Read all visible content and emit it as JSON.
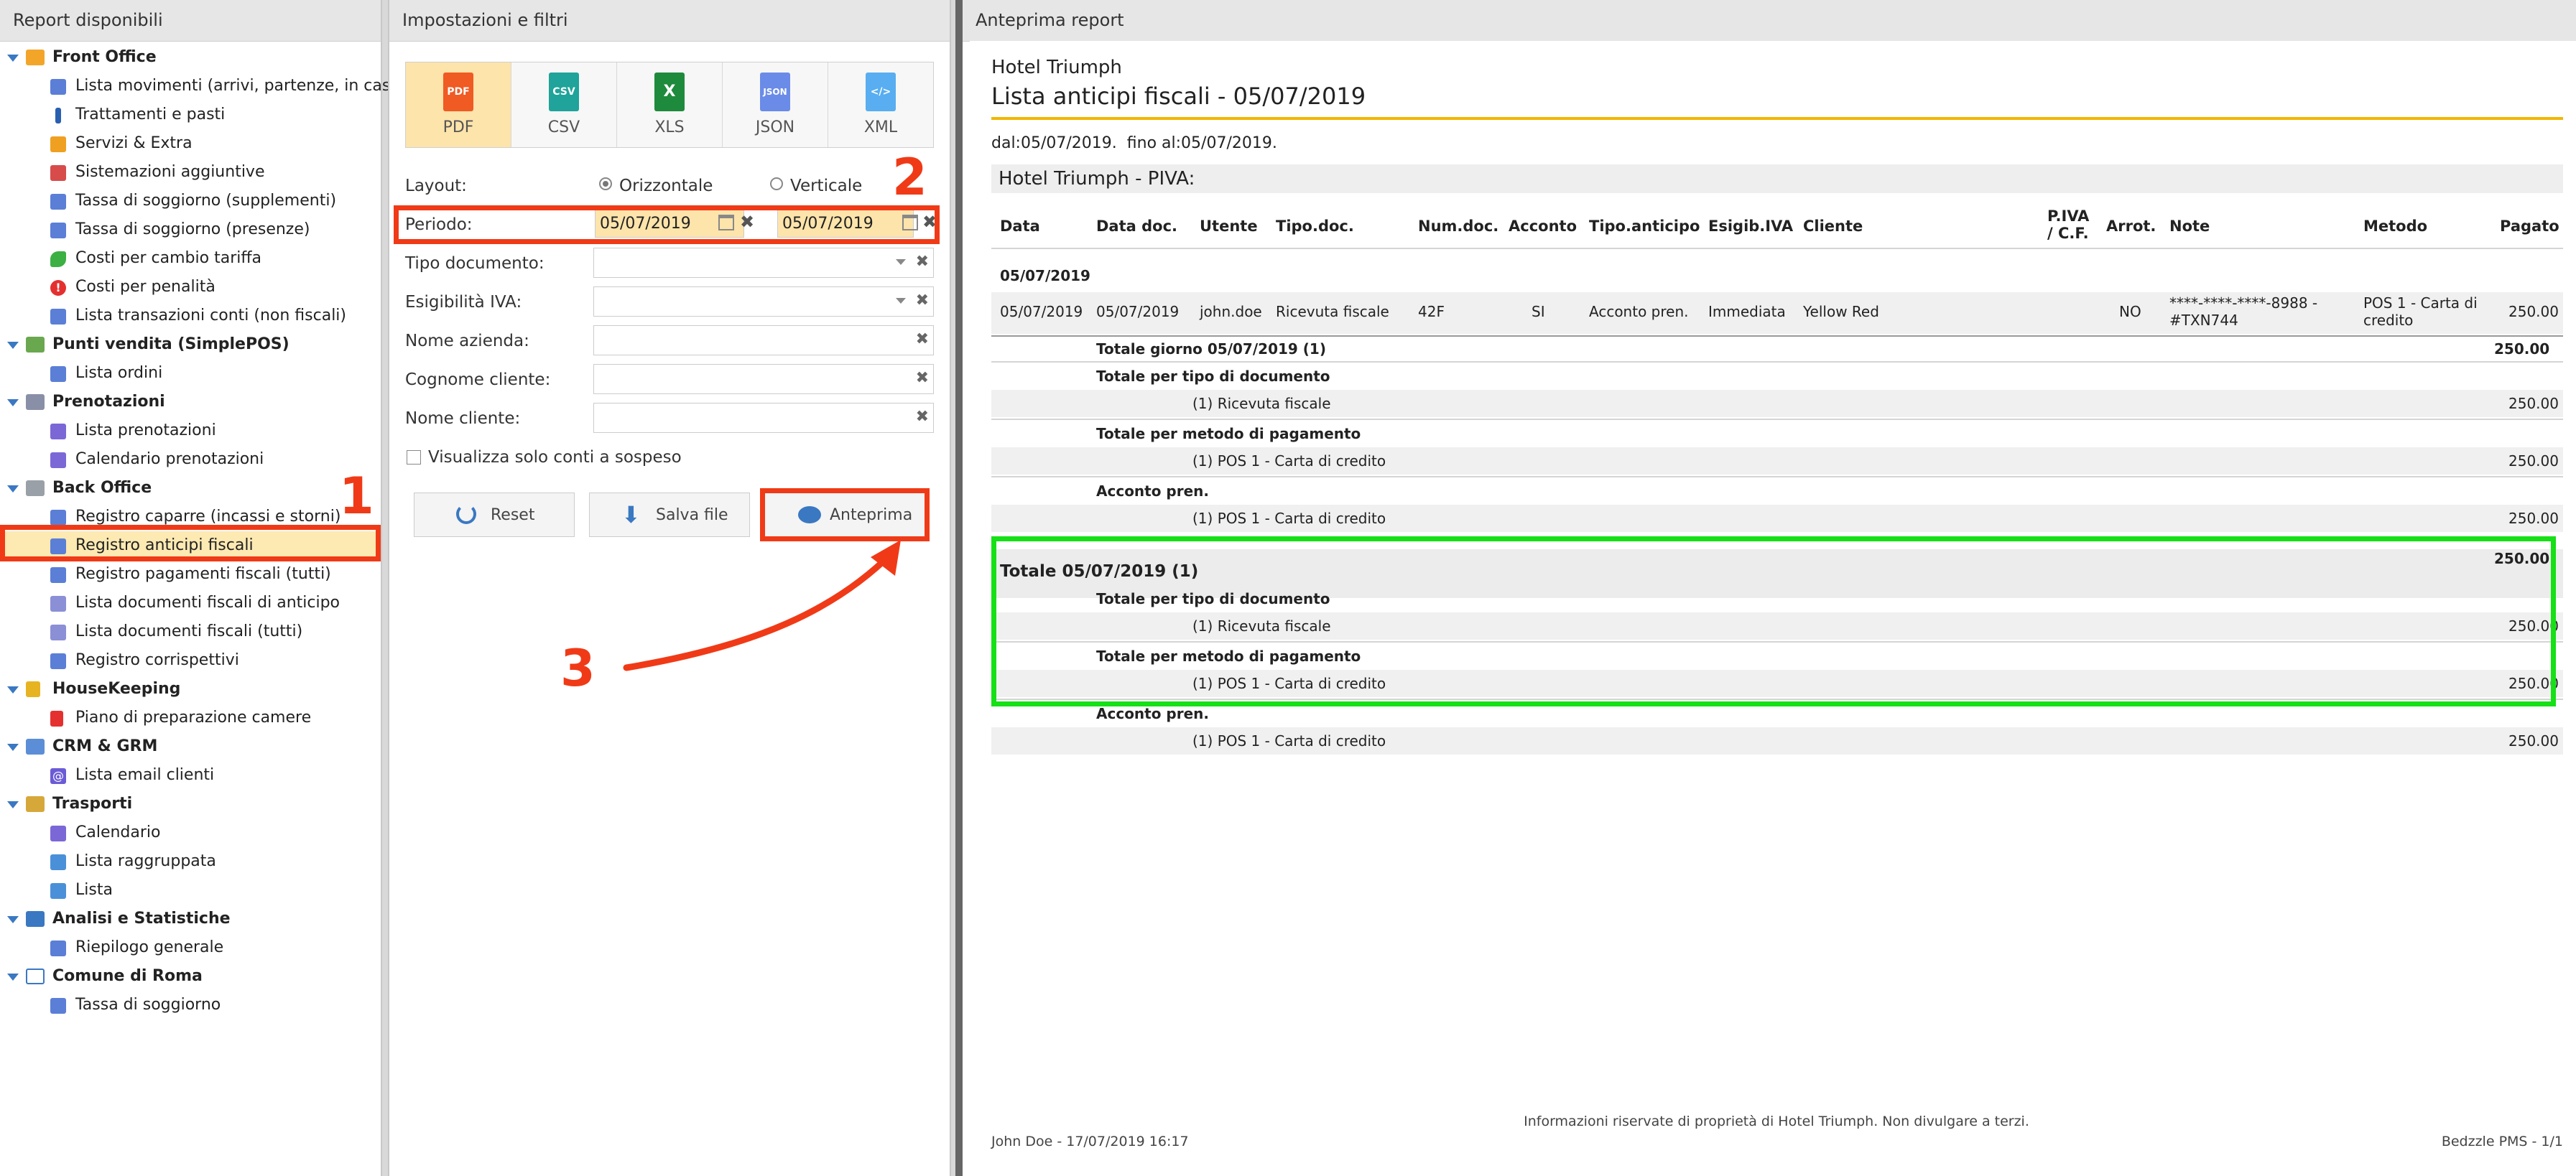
{
  "left": {
    "title": "Report disponibili",
    "groups": [
      {
        "label": "Front Office",
        "items": [
          "Lista movimenti (arrivi, partenze, in casa)",
          "Trattamenti e pasti",
          "Servizi & Extra",
          "Sistemazioni aggiuntive",
          "Tassa di soggiorno (supplementi)",
          "Tassa di soggiorno (presenze)",
          "Costi per cambio tariffa",
          "Costi per penalità",
          "Lista transazioni conti (non fiscali)"
        ]
      },
      {
        "label": "Punti vendita (SimplePOS)",
        "items": [
          "Lista ordini"
        ]
      },
      {
        "label": "Prenotazioni",
        "items": [
          "Lista prenotazioni",
          "Calendario prenotazioni"
        ]
      },
      {
        "label": "Back Office",
        "items": [
          "Registro caparre (incassi e storni)",
          "Registro anticipi fiscali",
          "Registro pagamenti fiscali (tutti)",
          "Lista documenti fiscali di anticipo",
          "Lista documenti fiscali (tutti)",
          "Registro corrispettivi"
        ]
      },
      {
        "label": "HouseKeeping",
        "items": [
          "Piano di preparazione camere"
        ]
      },
      {
        "label": "CRM & GRM",
        "items": [
          "Lista email clienti"
        ]
      },
      {
        "label": "Trasporti",
        "items": [
          "Calendario",
          "Lista raggruppata",
          "Lista"
        ]
      },
      {
        "label": "Analisi e Statistiche",
        "items": [
          "Riepilogo generale"
        ]
      },
      {
        "label": "Comune di Roma",
        "items": [
          "Tassa di soggiorno"
        ]
      }
    ]
  },
  "mid": {
    "title": "Impostazioni e filtri",
    "formats": [
      "PDF",
      "CSV",
      "XLS",
      "JSON",
      "XML"
    ],
    "layout_label": "Layout:",
    "layout_h": "Orizzontale",
    "layout_v": "Verticale",
    "periodo_label": "Periodo:",
    "date_from": "05/07/2019",
    "date_to": "05/07/2019",
    "tipo_doc_label": "Tipo documento:",
    "esig_label": "Esigibilità IVA:",
    "azienda_label": "Nome azienda:",
    "cognome_label": "Cognome cliente:",
    "nome_label": "Nome cliente:",
    "sospeso_label": "Visualizza solo conti a sospeso",
    "reset": "Reset",
    "salva": "Salva file",
    "anteprima": "Anteprima"
  },
  "annotations": {
    "n1": "1",
    "n2": "2",
    "n3": "3"
  },
  "right": {
    "title": "Anteprima report",
    "hotel": "Hotel Triumph",
    "report_title": "Lista anticipi fiscali - 05/07/2019",
    "period_from_label": "dal:",
    "period_from": "05/07/2019",
    "period_to_label": "fino al:",
    "period_to": "05/07/2019",
    "company": "Hotel Triumph - PIVA:",
    "headers": {
      "data": "Data",
      "datadoc": "Data doc.",
      "utente": "Utente",
      "tipodoc": "Tipo.doc.",
      "numdoc": "Num.doc.",
      "acconto": "Acconto",
      "tipoant": "Tipo.anticipo",
      "esig": "Esigib.IVA",
      "cliente": "Cliente",
      "piva1": "P.IVA",
      "piva2": "/ C.F.",
      "arrot": "Arrot.",
      "note": "Note",
      "metodo": "Metodo",
      "pagato": "Pagato"
    },
    "group_date": "05/07/2019",
    "row": {
      "data": "05/07/2019",
      "datadoc": "05/07/2019",
      "utente": "john.doe",
      "tipodoc": "Ricevuta fiscale",
      "numdoc": "42F",
      "acconto": "SI",
      "tipoant": "Acconto pren.",
      "esig": "Immediata",
      "cliente": "Yellow Red",
      "arrot": "NO",
      "note1": "****-****-****-8988 -",
      "note2": "#TXN744",
      "metodo1": "POS 1 - Carta di",
      "metodo2": "credito",
      "pagato": "250.00"
    },
    "tot_giorno": "Totale giorno 05/07/2019 (1)",
    "tot_giorno_val": "250.00",
    "tot_tipo": "Totale per tipo di documento",
    "ric_fiscale": "(1) Ricevuta fiscale",
    "tot_metodo": "Totale per metodo di pagamento",
    "pos1": "(1) POS 1 - Carta di credito",
    "acconto_pren": "Acconto pren.",
    "val": "250.00",
    "grand_total": "Totale 05/07/2019 (1)",
    "footer_note": "Informazioni riservate di proprietà di Hotel Triumph. Non divulgare a terzi.",
    "footer_left": "John Doe - 17/07/2019 16:17",
    "footer_right": "Bedzzle PMS - 1/1"
  },
  "colors": {
    "accent": "#f2b600",
    "highlight": "#fde4ab",
    "annotation_red": "#f03a17",
    "annotation_green": "#16e016",
    "tree_triangle": "#3a78c2"
  }
}
